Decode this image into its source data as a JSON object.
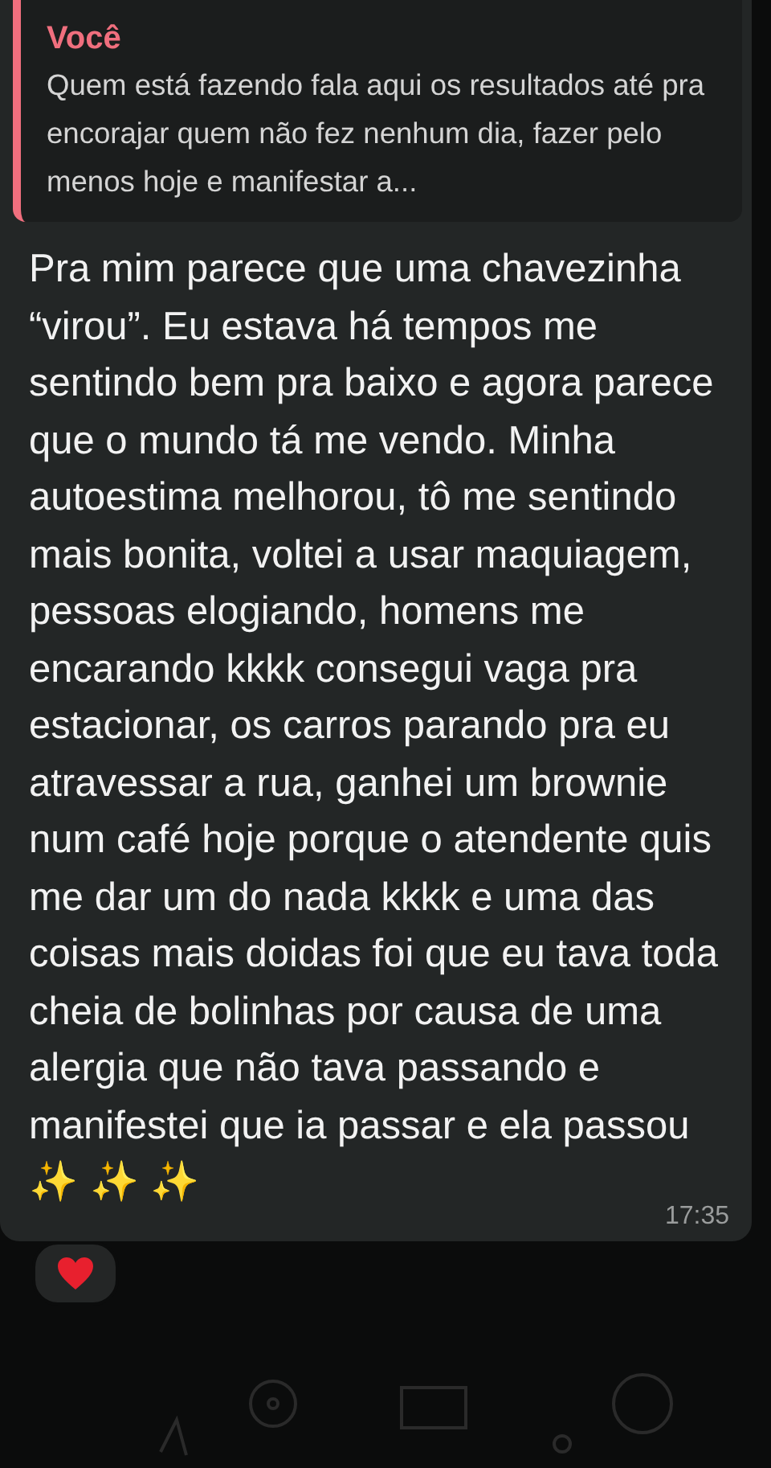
{
  "message": {
    "quote": {
      "author": "Você",
      "text": "Quem está fazendo fala aqui os resultados até pra encorajar quem não fez nenhum dia, fazer pelo menos hoje e manifestar a..."
    },
    "text": "Pra mim parece que uma chavezinha “virou”. Eu estava há tempos me sentindo bem pra baixo e agora parece que o mundo tá me vendo. Minha autoestima melhorou, tô me sentindo mais bonita, voltei a usar maquiagem, pessoas elogiando, homens me encarando kkkk consegui vaga pra estacionar, os carros parando pra eu atravessar a rua, ganhei um brownie num café hoje porque o atendente quis me dar um do nada kkkk e uma das coisas mais doidas foi que eu tava toda cheia de bolinhas por causa de uma alergia que não tava passando e manifestei que ia passar e ela passou ✨ ✨ ✨",
    "time": "17:35",
    "reactions": [
      {
        "kind": "heart"
      }
    ]
  }
}
